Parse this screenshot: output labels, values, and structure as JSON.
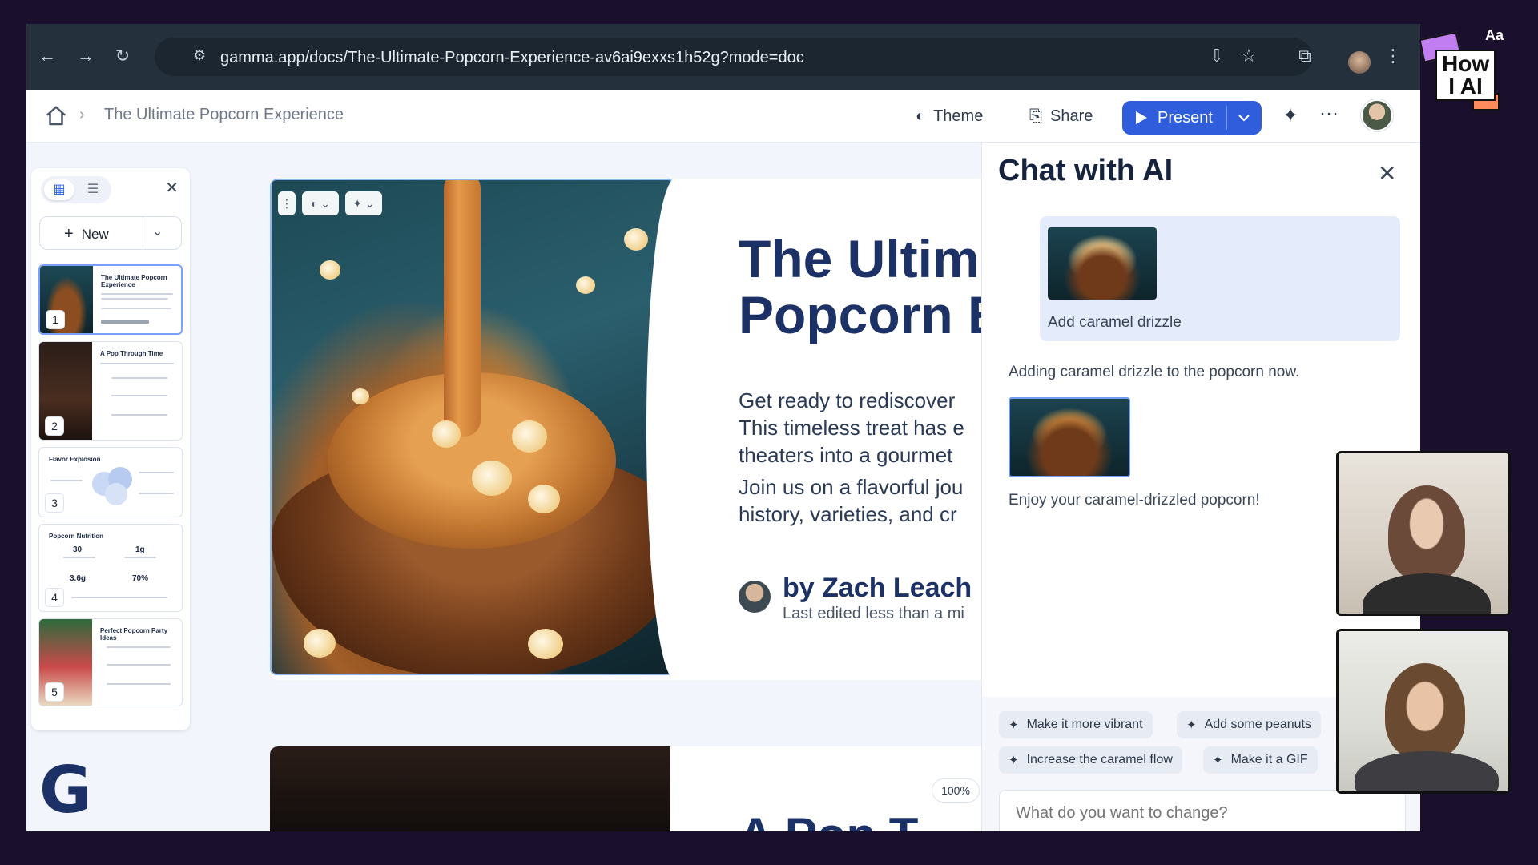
{
  "browser": {
    "url": "gamma.app/docs/The-Ultimate-Popcorn-Experience-av6ai9exxs1h52g?mode=doc",
    "icons": [
      "back-icon",
      "forward-icon",
      "reload-icon",
      "site-settings-icon",
      "install-icon",
      "star-icon",
      "extensions-icon",
      "profile-icon",
      "menu-icon"
    ]
  },
  "header": {
    "breadcrumb_title": "The Ultimate Popcorn Experience",
    "theme_label": "Theme",
    "share_label": "Share",
    "present_label": "Present"
  },
  "sidebar": {
    "new_label": "New",
    "thumbnails": [
      {
        "num": "1",
        "title": "The Ultimate Popcorn Experience"
      },
      {
        "num": "2",
        "title": "A Pop Through Time"
      },
      {
        "num": "3",
        "title": "Flavor Explosion"
      },
      {
        "num": "4",
        "title": "Popcorn Nutrition",
        "stats": [
          "30",
          "1g",
          "3.6g",
          "70%"
        ]
      },
      {
        "num": "5",
        "title": "Perfect Popcorn Party Ideas"
      }
    ]
  },
  "card": {
    "title_line1": "The Ultim",
    "title_line2": "Popcorn E",
    "para1_line1": "Get ready to rediscover",
    "para1_line2": "This timeless treat has e",
    "para1_line3": "theaters into a gourmet",
    "para2_line1": "Join us on a flavorful jou",
    "para2_line2": "history, varieties, and cr",
    "author": "by Zach Leach",
    "last_edited": "Last edited less than a mi"
  },
  "card2": {
    "title": "A Pop T"
  },
  "zoom": "100%",
  "ai_panel": {
    "title": "Chat with AI",
    "user_message": "Add caramel drizzle",
    "ai_message_1": "Adding caramel drizzle to the popcorn now.",
    "ai_message_2": "Enjoy your caramel-drizzled popcorn!",
    "suggestions": [
      "Make it more vibrant",
      "Add some peanuts",
      "Increase the caramel flow",
      "Make it a GIF"
    ],
    "input_placeholder": "What do you want to change?"
  },
  "overlay": {
    "logo_line1": "How",
    "logo_line2": "I AI",
    "logo_corner": "Aa"
  },
  "colors": {
    "accent": "#2f5ddb",
    "title": "#1c3166",
    "outer_bg": "#1b0f2e"
  }
}
